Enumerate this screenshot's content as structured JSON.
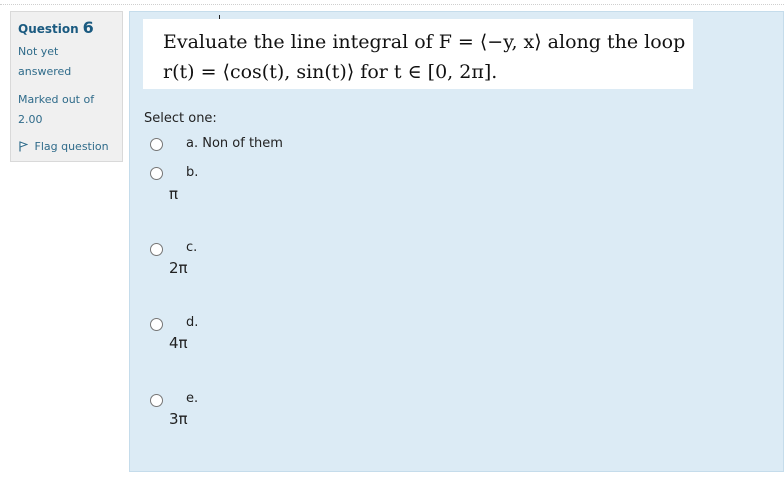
{
  "info": {
    "question_label": "Question",
    "question_number": "6",
    "status_line1": "Not yet",
    "status_line2": "answered",
    "marked_line1": "Marked out of",
    "marked_line2": "2.00",
    "flag_label": "Flag question",
    "flag_icon": "flag-icon"
  },
  "question": {
    "line1": "Evaluate the line integral of F = ⟨−y, x⟩ along the loop",
    "line2": "r(t) = ⟨cos(t), sin(t)⟩ for t ∈ [0, 2π]."
  },
  "answer": {
    "prompt": "Select one:",
    "options": [
      {
        "letter": "a.",
        "text": "Non of them",
        "value": ""
      },
      {
        "letter": "b.",
        "text": "",
        "value": "π"
      },
      {
        "letter": "c.",
        "text": "",
        "value": "2π"
      },
      {
        "letter": "d.",
        "text": "",
        "value": "4π"
      },
      {
        "letter": "e.",
        "text": "",
        "value": "3π"
      }
    ]
  },
  "colors": {
    "content_bg": "#dcebf5",
    "info_bg": "#f0f0f0",
    "accent": "#1a5a80"
  }
}
